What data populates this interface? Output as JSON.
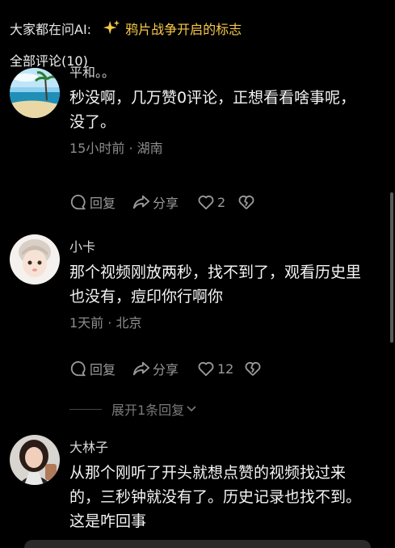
{
  "ask_ai": {
    "label": "大家都在问AI:",
    "topic": "鸦片战争开启的标志",
    "accent_color": "#f7c948"
  },
  "comments_header": "全部评论(10)",
  "comments": [
    {
      "name": "平和。。",
      "avatar": "beach-landscape-avatar",
      "text_lines": [
        "秒没啊，几万赞0评论，正想看看啥事呢，",
        "没了。"
      ],
      "meta": "15小时前 · 湖南",
      "reply_label": "回复",
      "share_label": "分享",
      "like_count": "2"
    },
    {
      "name": "小卡",
      "avatar": "child-portrait-avatar",
      "text_lines": [
        "那个视频刚放两秒，找不到了，观看历史里",
        "也没有，痘印你行啊你"
      ],
      "meta": "1天前 · 北京",
      "reply_label": "回复",
      "share_label": "分享",
      "like_count": "12"
    },
    {
      "name": "大林子",
      "avatar": "woman-portrait-avatar",
      "text_lines": [
        "从那个刚听了开头就想点赞的视频找过来",
        "的，三秒钟就没有了。历史记录也找不到。",
        "这是咋回事"
      ]
    }
  ],
  "expand_replies": "展开1条回复"
}
